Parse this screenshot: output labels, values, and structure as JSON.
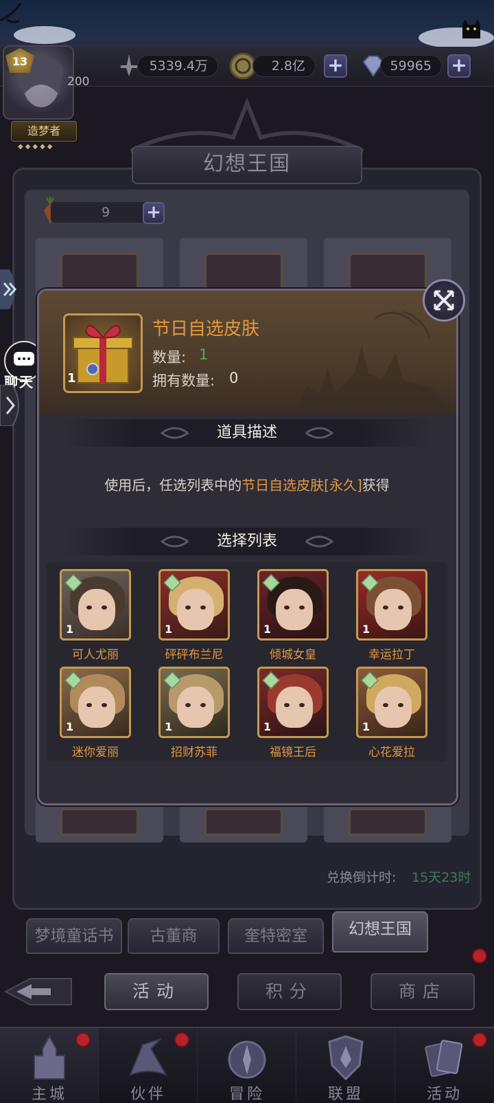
{
  "top_bar": {
    "power_value": "5339.4万",
    "gold_value": "2.8亿",
    "gems_value": "59965",
    "level": "13",
    "level_progress": "200",
    "player_title": "造梦者"
  },
  "panel": {
    "title": "幻想王国",
    "carrot_count": "9",
    "countdown_label": "兑换倒计时:",
    "countdown_value": "15天23时"
  },
  "side": {
    "chat_label": "聊天"
  },
  "modal": {
    "item_name": "节日自选皮肤",
    "item_icon_count": "1",
    "qty_label": "数量:",
    "qty_value": "1",
    "own_label": "拥有数量:",
    "own_value": "0",
    "desc_title": "道具描述",
    "desc_prefix": "使用后，任选列表中的",
    "desc_highlight": "节日自选皮肤[永久]",
    "desc_suffix": "获得",
    "list_title": "选择列表",
    "skins": [
      {
        "name": "可人尤丽",
        "count": "1"
      },
      {
        "name": "砰砰布兰尼",
        "count": "1"
      },
      {
        "name": "倾城女皇",
        "count": "1"
      },
      {
        "name": "幸运拉丁",
        "count": "1"
      },
      {
        "name": "迷你爱丽",
        "count": "1"
      },
      {
        "name": "招财苏菲",
        "count": "1"
      },
      {
        "name": "福镜王后",
        "count": "1"
      },
      {
        "name": "心花爱拉",
        "count": "1"
      }
    ]
  },
  "tabs": [
    "梦境童话书",
    "古董商",
    "奎特密室",
    "幻想王国"
  ],
  "sub_buttons": [
    "活动",
    "积分",
    "商店"
  ],
  "bottom_nav": [
    "主城",
    "伙伴",
    "冒险",
    "联盟",
    "活动"
  ],
  "colors": {
    "accent_orange": "#e29a3c",
    "green_value": "#4fae55",
    "gold_border": "#c49a52",
    "notify_red": "#b8232b"
  }
}
